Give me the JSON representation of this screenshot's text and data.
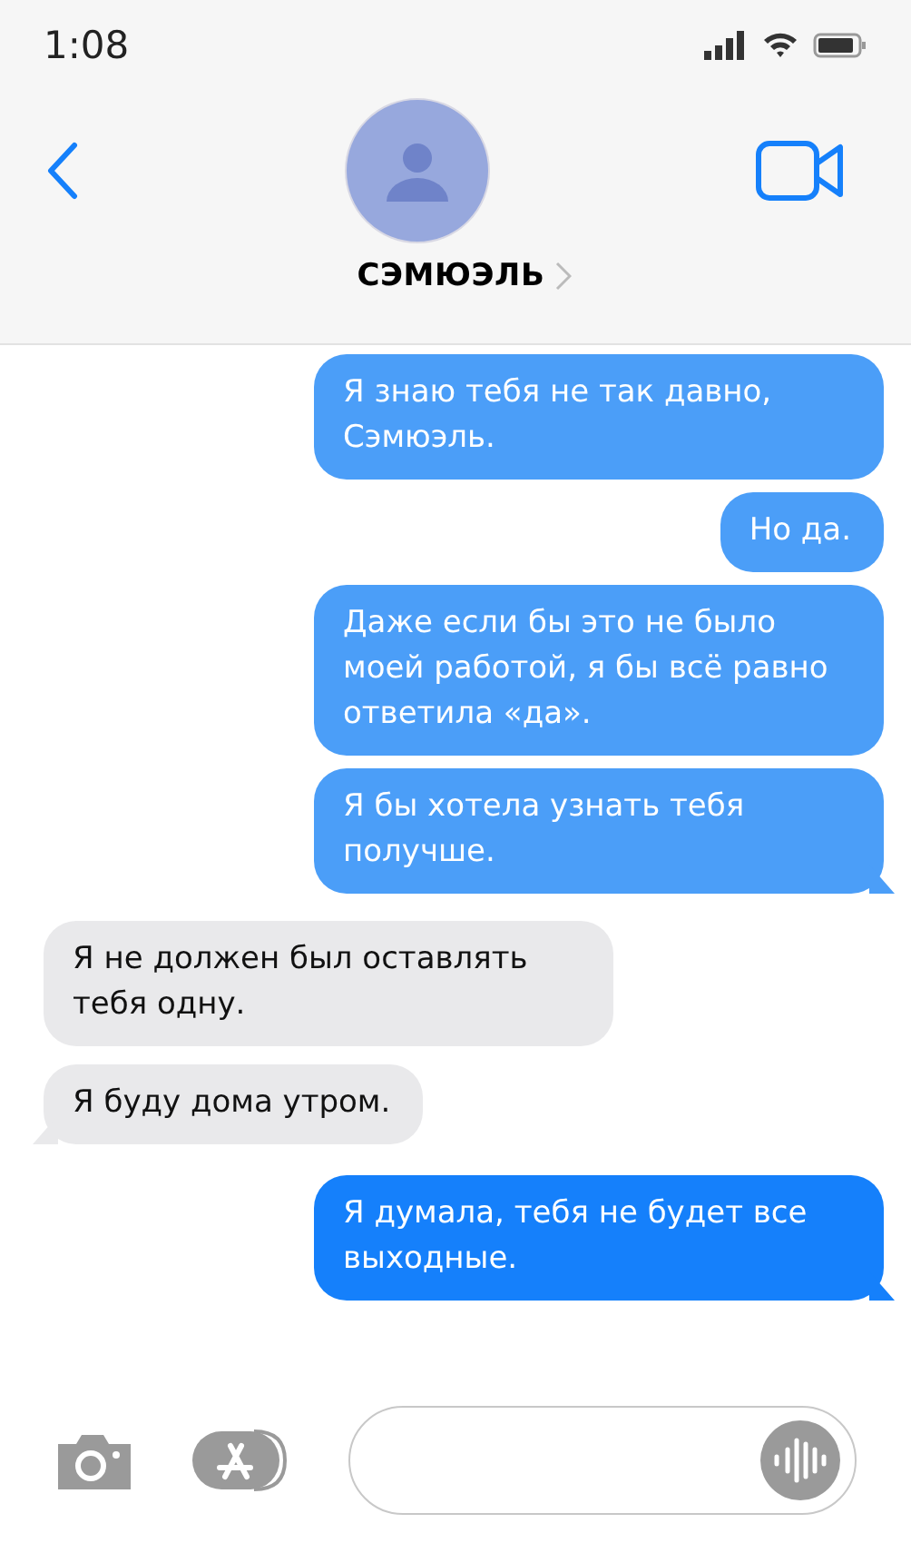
{
  "status_bar": {
    "time": "1:08"
  },
  "header": {
    "contact_name": "СЭМЮЭЛЬ"
  },
  "messages": [
    {
      "kind": "sent",
      "text": "Я знаю тебя не так давно, Сэмюэль.",
      "color": "#4b9ef8",
      "tail": false
    },
    {
      "kind": "sent",
      "text": "Но да.",
      "color": "#4b9ef8",
      "tail": false
    },
    {
      "kind": "sent",
      "text": "Даже если бы это не было моей работой, я бы всё равно ответила «да».",
      "color": "#4b9ef8",
      "tail": false
    },
    {
      "kind": "sent",
      "text": "Я бы хотела узнать тебя получше.",
      "color": "#4b9ef8",
      "tail": true
    },
    {
      "kind": "received",
      "text": "Я не должен был оставлять тебя одну.",
      "color": "#e9e9eb",
      "tail": false
    },
    {
      "kind": "received",
      "text": "Я буду дома утром.",
      "color": "#e9e9eb",
      "tail": true
    },
    {
      "kind": "sent",
      "text": "Я думала, тебя не будет все выходные.",
      "color": "#1580fb",
      "tail": true
    }
  ]
}
